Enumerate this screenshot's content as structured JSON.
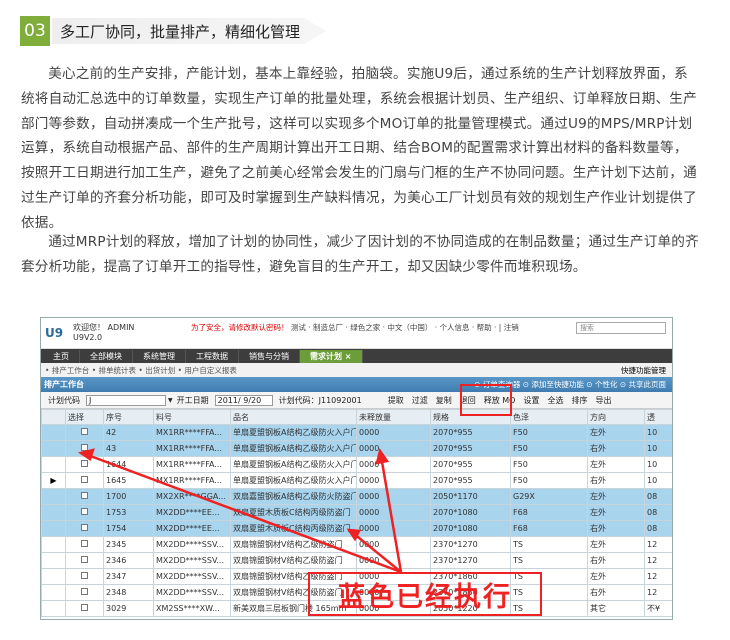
{
  "section": {
    "number": "03",
    "title": "多工厂协同，批量排产，精细化管理"
  },
  "paragraphs": [
    "美心之前的生产安排，产能计划，基本上靠经验，拍脑袋。实施U9后，通过系统的生产计划释放界面，系统将自动汇总选中的订单数量，实现生产订单的批量处理，系统会根据计划员、生产组织、订单释放日期、生产部门等参数，自动拼凑成一个生产批号，这样可以实现多个MO订单的批量管理模式。通过U9的MPS/MRP计划运算，系统自动根据产品、部件的生产周期计算出开工日期、结合BOM的配置需求计算出材料的备料数量等，按照开工日期进行加工生产，避免了之前美心经常会发生的门扇与门框的生产不协同问题。生产计划下达前，通过生产订单的齐套分析功能，即可及时掌握到生产缺料情况，为美心工厂计划员有效的规划生产作业计划提供了依据。",
    "通过MRP计划的释放，增加了计划的协同性，减少了因计划的不协同造成的在制品数量；通过生产订单的齐套分析功能，提高了订单开工的指导性，避免盲目的生产开工，却又因缺少零件而堆积现场。"
  ],
  "app": {
    "logo": "U9",
    "welcome": "欢迎您！ ADMIN",
    "version": "U9V2.0",
    "warning": "为了安全，请修改默认密码！",
    "top_links": "测试 · 制造总厂 · 绿色之家 · 中文（中国） · 个人信息 · 帮助 · | 注销",
    "search_placeholder": "搜索",
    "menu_tabs": [
      "主页",
      "全部模块",
      "系统管理",
      "工程数据",
      "销售与分销",
      "需求计划 ×"
    ],
    "sub_links": "• 排产工作台 • 排单统计表 • 出货计划 • 用户自定义报表",
    "sub_right": "快捷功能管理",
    "work_title": "排产工作台",
    "work_right": "⊙ 订单查询器  ⊙ 添加至快捷功能  ⊙ 个性化  ⊙ 共享此页面",
    "toolbar": {
      "plan_code_label": "计划代码",
      "plan_code_value": "J",
      "start_date_label": "开工日期",
      "start_date_value": "2011/ 9/20",
      "plan_code2": "计划代码：J11092001",
      "buttons": [
        "提取",
        "过滤",
        "复制",
        "退回",
        "释放 MO",
        "设置",
        "全选",
        "排序",
        "导出"
      ]
    },
    "columns": [
      "",
      "选择",
      "序号",
      "料号",
      "品名",
      "未释放量",
      "规格",
      "色泽",
      "方向",
      "透"
    ],
    "rows": [
      {
        "seq": "42",
        "part": "MX1RR****FFA...",
        "name": "单扇夏盟钢板A结构乙级防火入户门",
        "qty": "0000",
        "spec": "2070*955",
        "color": "F50",
        "dir": "左外",
        "x": "10",
        "style": "blue",
        "arrow": ""
      },
      {
        "seq": "43",
        "part": "MX1RR****FFA...",
        "name": "单扇夏盟钢板A结构乙级防火入户门",
        "qty": "0000",
        "spec": "2070*955",
        "color": "F50",
        "dir": "右外",
        "x": "10",
        "style": "blue",
        "arrow": ""
      },
      {
        "seq": "1644",
        "part": "MX1RR****FFA...",
        "name": "单扇夏盟钢板A结构乙级防火入户门",
        "qty": "0000",
        "spec": "2070*955",
        "color": "F50",
        "dir": "左外",
        "x": "10",
        "style": "white",
        "arrow": ""
      },
      {
        "seq": "1645",
        "part": "MX1RR****FFA...",
        "name": "单扇夏盟钢板A结构乙级防火入户门",
        "qty": "0000",
        "spec": "2070*955",
        "color": "F50",
        "dir": "右外",
        "x": "10",
        "style": "white",
        "arrow": "▶"
      },
      {
        "seq": "1700",
        "part": "MX2XR****GGA...",
        "name": "双扇嘉盟钢板A结构乙级防火防盗门",
        "qty": "0000",
        "spec": "2050*1170",
        "color": "G29X",
        "dir": "左外",
        "x": "08",
        "style": "blue",
        "arrow": ""
      },
      {
        "seq": "1753",
        "part": "MX2DD****EE...",
        "name": "双扇夏盟木质板C结构丙级防盗门",
        "qty": "0000",
        "spec": "2070*1080",
        "color": "F68",
        "dir": "左外",
        "x": "08",
        "style": "blue",
        "arrow": ""
      },
      {
        "seq": "1754",
        "part": "MX2DD****EE...",
        "name": "双扇夏盟木质板C结构丙级防盗门",
        "qty": "0000",
        "spec": "2070*1080",
        "color": "F68",
        "dir": "右外",
        "x": "08",
        "style": "blue",
        "arrow": ""
      },
      {
        "seq": "2345",
        "part": "MX2DD****SSV...",
        "name": "双扇锦盟钢材V结构乙级防盗门",
        "qty": "0000",
        "spec": "2370*1270",
        "color": "TS",
        "dir": "左外",
        "x": "12",
        "style": "white",
        "arrow": ""
      },
      {
        "seq": "2346",
        "part": "MX2DD****SSV...",
        "name": "双扇锦盟钢材V结构乙级防盗门",
        "qty": "0000",
        "spec": "2370*1270",
        "color": "TS",
        "dir": "右外",
        "x": "12",
        "style": "white",
        "arrow": ""
      },
      {
        "seq": "2347",
        "part": "MX2DD****SSV...",
        "name": "双扇锦盟钢材V结构乙级防盗门",
        "qty": "0000",
        "spec": "2370*1860",
        "color": "TS",
        "dir": "左外",
        "x": "12",
        "style": "white",
        "arrow": ""
      },
      {
        "seq": "2348",
        "part": "MX2DD****SSV...",
        "name": "双扇锦盟钢材V结构乙级防盗门",
        "qty": "0000",
        "spec": "2370*1860",
        "color": "TS",
        "dir": "右外",
        "x": "12",
        "style": "white",
        "arrow": ""
      },
      {
        "seq": "3029",
        "part": "XM2SS****XW...",
        "name": "新美双扇三层板钢门楼 165mm",
        "qty": "0000",
        "spec": "2050*1220",
        "color": "TS",
        "dir": "其它",
        "x": "不¥",
        "style": "white",
        "arrow": ""
      }
    ],
    "annotation": "蓝色已经执行"
  }
}
